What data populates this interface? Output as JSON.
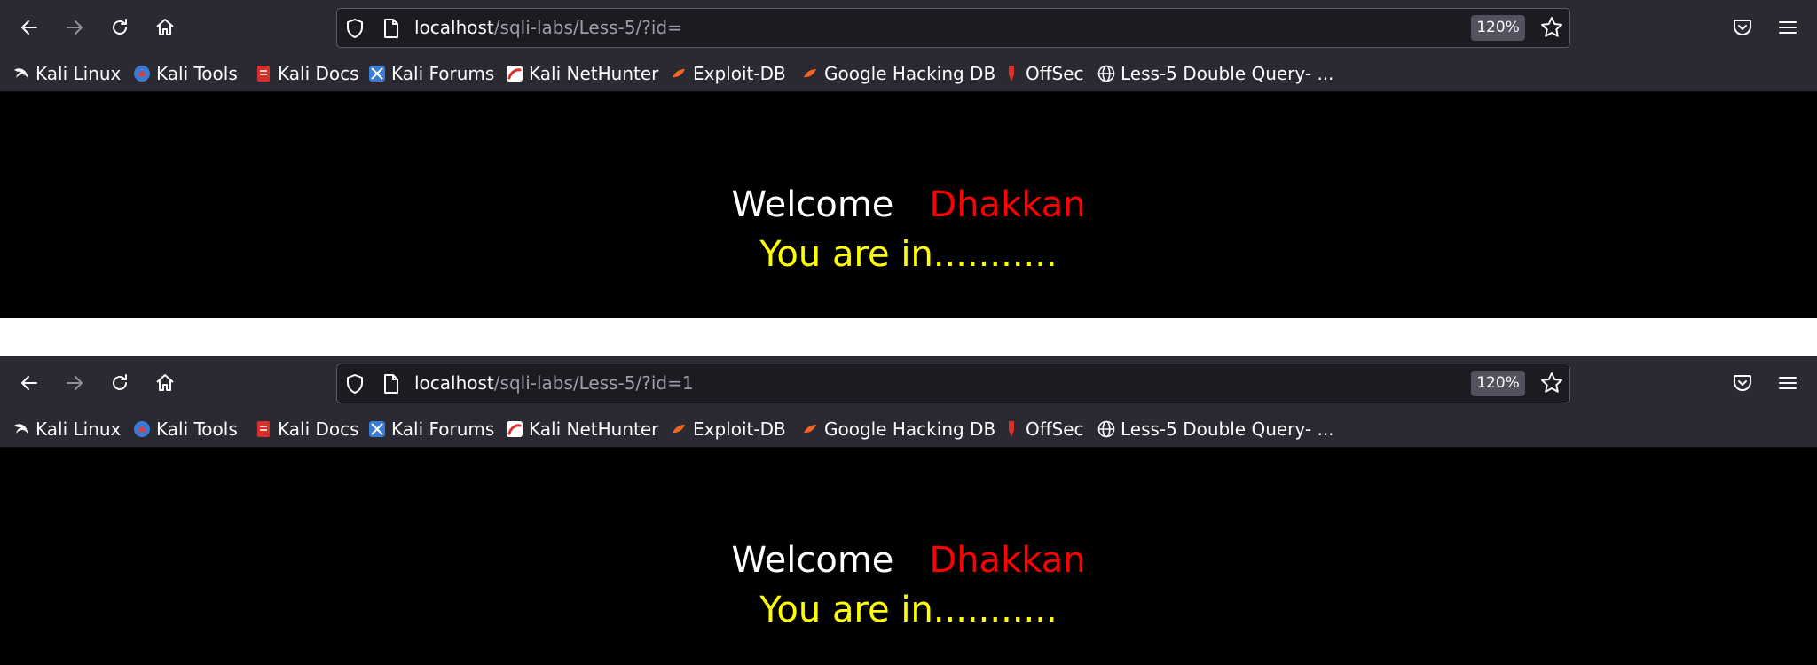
{
  "colors": {
    "toolbar_bg": "#2b2a33",
    "urlbar_bg": "#1c1b22",
    "page_bg": "#000000",
    "welcome_text": "#ffffff",
    "name_text": "#ff0000",
    "status_text": "#ffff00"
  },
  "bookmarks": [
    {
      "label": "Kali Linux",
      "icon": "kali-dragon-icon"
    },
    {
      "label": "Kali Tools",
      "icon": "kali-tools-icon"
    },
    {
      "label": "Kali Docs",
      "icon": "kali-docs-icon"
    },
    {
      "label": "Kali Forums",
      "icon": "kali-forums-icon"
    },
    {
      "label": "Kali NetHunter",
      "icon": "nethunter-icon"
    },
    {
      "label": "Exploit-DB",
      "icon": "exploit-db-icon"
    },
    {
      "label": "Google Hacking DB",
      "icon": "ghdb-icon"
    },
    {
      "label": "OffSec",
      "icon": "offsec-icon"
    },
    {
      "label": "Less-5 Double Query- ...",
      "icon": "globe-icon"
    }
  ],
  "shots": [
    {
      "url_host": "localhost",
      "url_path": "/sqli-labs/Less-5/?id=",
      "zoom": "120%",
      "welcome": "Welcome",
      "name": "Dhakkan",
      "status": "You are in..........."
    },
    {
      "url_host": "localhost",
      "url_path": "/sqli-labs/Less-5/?id=1",
      "zoom": "120%",
      "welcome": "Welcome",
      "name": "Dhakkan",
      "status": "You are in..........."
    }
  ]
}
